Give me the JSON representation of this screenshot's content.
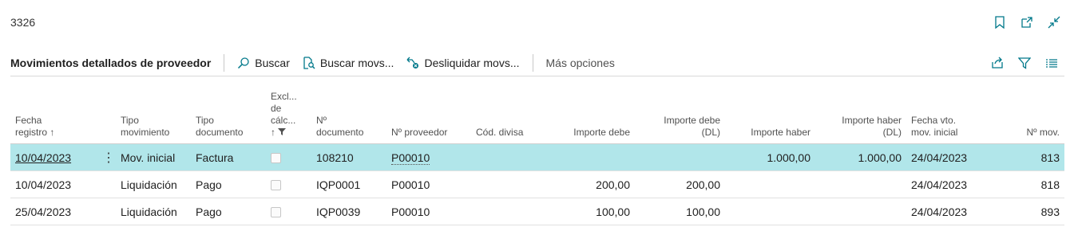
{
  "window": {
    "title": "3326"
  },
  "toolbar": {
    "page_title": "Movimientos detallados de proveedor",
    "actions": [
      {
        "label": "Buscar",
        "icon": "search-icon"
      },
      {
        "label": "Buscar movs...",
        "icon": "find-entries-icon"
      },
      {
        "label": "Desliquidar movs...",
        "icon": "unapply-icon"
      }
    ],
    "more": "Más opciones"
  },
  "columns": [
    {
      "line1": "Fecha",
      "line2": "registro ↑",
      "line3": ""
    },
    {
      "line1": "",
      "line2": "",
      "line3": ""
    },
    {
      "line1": "Tipo",
      "line2": "movimiento",
      "line3": ""
    },
    {
      "line1": "Tipo",
      "line2": "documento",
      "line3": ""
    },
    {
      "line1": "Excl...",
      "line2": "de",
      "line3": "cálc...",
      "line4": "↑"
    },
    {
      "line1": "Nº",
      "line2": "documento",
      "line3": ""
    },
    {
      "line1": "",
      "line2": "Nº proveedor",
      "line3": ""
    },
    {
      "line1": "",
      "line2": "Cód. divisa",
      "line3": ""
    },
    {
      "line1": "",
      "line2": "Importe debe",
      "line3": ""
    },
    {
      "line1": "Importe debe",
      "line2": "(DL)",
      "line3": ""
    },
    {
      "line1": "",
      "line2": "Importe haber",
      "line3": ""
    },
    {
      "line1": "Importe haber",
      "line2": "(DL)",
      "line3": ""
    },
    {
      "line1": "Fecha vto.",
      "line2": "mov. inicial",
      "line3": ""
    },
    {
      "line1": "",
      "line2": "Nº mov.",
      "line3": ""
    }
  ],
  "rows": [
    {
      "fecha": "10/04/2023",
      "tipo_mov": "Mov. inicial",
      "tipo_doc": "Factura",
      "excl": false,
      "n_doc": "108210",
      "proveedor": "P00010",
      "divisa": "",
      "debe": "",
      "debe_dl": "",
      "haber": "1.000,00",
      "haber_dl": "1.000,00",
      "vto": "24/04/2023",
      "n_mov": "813",
      "selected": true
    },
    {
      "fecha": "10/04/2023",
      "tipo_mov": "Liquidación",
      "tipo_doc": "Pago",
      "excl": false,
      "n_doc": "IQP0001",
      "proveedor": "P00010",
      "divisa": "",
      "debe": "200,00",
      "debe_dl": "200,00",
      "haber": "",
      "haber_dl": "",
      "vto": "24/04/2023",
      "n_mov": "818",
      "selected": false
    },
    {
      "fecha": "25/04/2023",
      "tipo_mov": "Liquidación",
      "tipo_doc": "Pago",
      "excl": false,
      "n_doc": "IQP0039",
      "proveedor": "P00010",
      "divisa": "",
      "debe": "100,00",
      "debe_dl": "100,00",
      "haber": "",
      "haber_dl": "",
      "vto": "24/04/2023",
      "n_mov": "893",
      "selected": false
    }
  ],
  "colors": {
    "selected_row": "#b1e6ea",
    "accent": "#00788a"
  }
}
